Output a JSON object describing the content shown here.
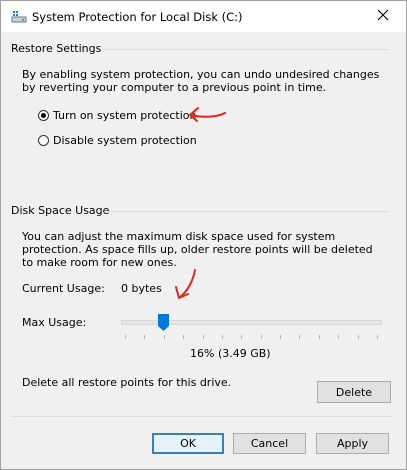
{
  "window": {
    "title": "System Protection for Local Disk (C:)",
    "icon": "drive-icon",
    "close_icon": "close-icon"
  },
  "restore_settings": {
    "heading": "Restore Settings",
    "description": "By enabling system protection, you can undo undesired changes by reverting your computer to a previous point in time.",
    "options": [
      {
        "label": "Turn on system protection",
        "selected": true
      },
      {
        "label": "Disable system protection",
        "selected": false
      }
    ]
  },
  "disk_space": {
    "heading": "Disk Space Usage",
    "description": "You can adjust the maximum disk space used for system protection. As space fills up, older restore points will be deleted to make room for new ones.",
    "current_usage_label": "Current Usage:",
    "current_usage_value": "0 bytes",
    "max_usage_label": "Max Usage:",
    "max_usage_value": "16% (3.49 GB)",
    "max_usage_fraction": 0.16
  },
  "delete_section": {
    "text": "Delete all restore points for this drive.",
    "delete_label": "Delete"
  },
  "footer": {
    "ok_label": "OK",
    "cancel_label": "Cancel",
    "apply_label": "Apply"
  },
  "colors": {
    "annotation": "#e0261c",
    "accent": "#0078d7"
  }
}
